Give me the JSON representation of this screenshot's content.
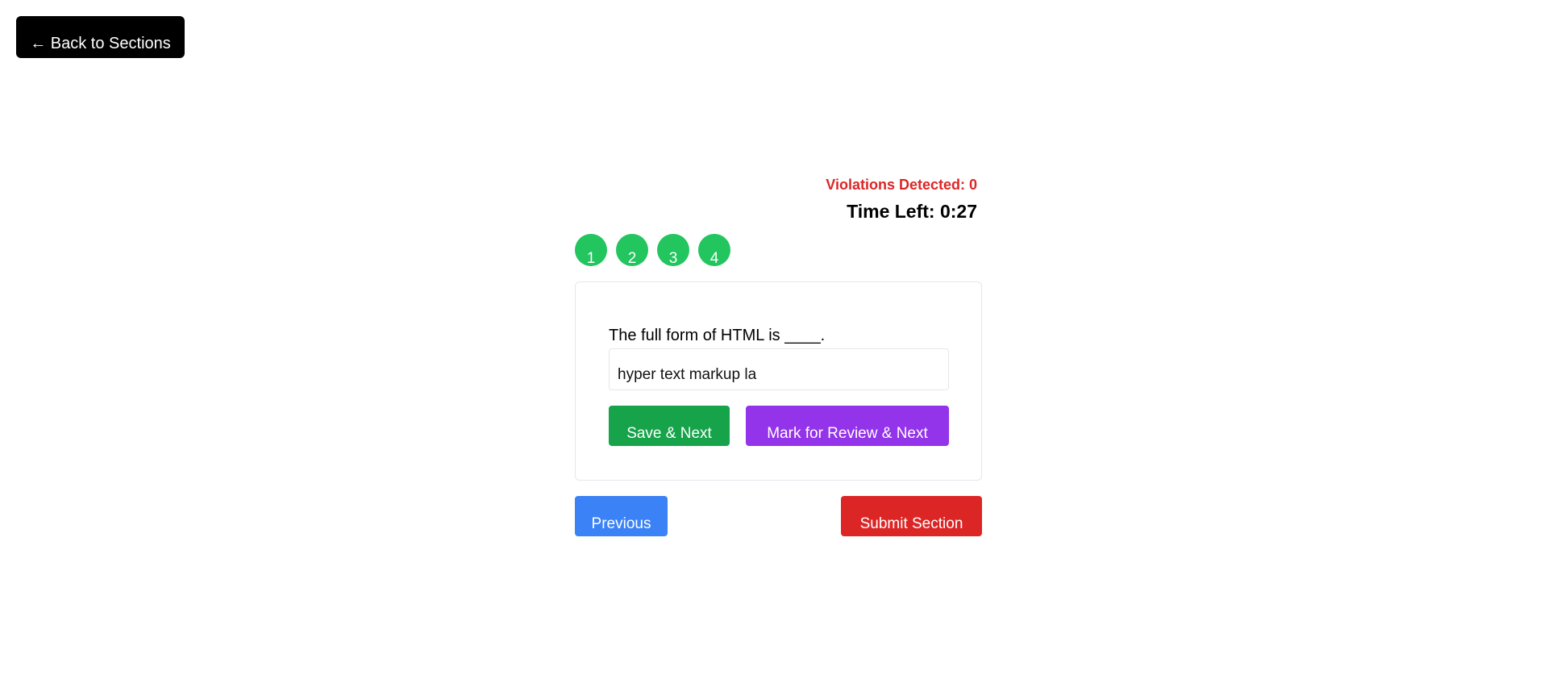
{
  "header": {
    "back_label": "← Back to Sections"
  },
  "status": {
    "violations_text": "Violations Detected: 0",
    "time_left_text": "Time Left: 0:27"
  },
  "question_nav": {
    "items": [
      "1",
      "2",
      "3",
      "4"
    ],
    "color": "#22c55e"
  },
  "question": {
    "text": "The full form of HTML is ____.",
    "answer_value": "hyper text markup la"
  },
  "actions": {
    "save_next_label": "Save & Next",
    "mark_review_label": "Mark for Review & Next",
    "previous_label": "Previous",
    "submit_label": "Submit Section"
  },
  "colors": {
    "back": "#000000",
    "violations": "#dc2626",
    "save": "#16a34a",
    "mark": "#9333ea",
    "previous": "#3b82f6",
    "submit": "#dc2626"
  }
}
